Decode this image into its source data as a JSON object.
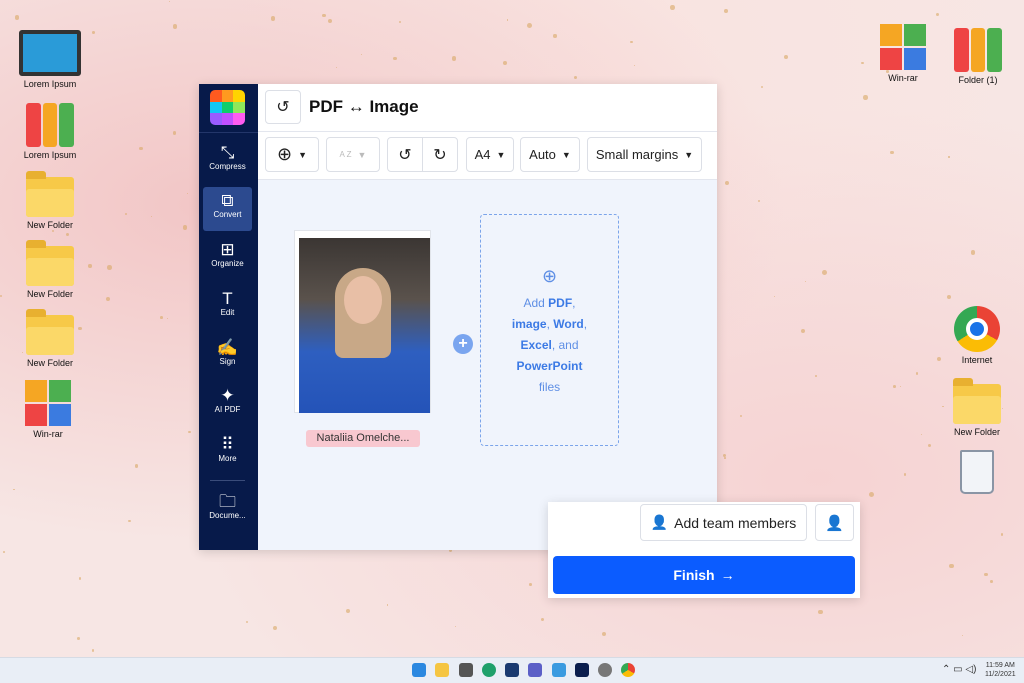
{
  "desktop": {
    "left_icons": [
      {
        "label": "Lorem Ipsum",
        "icon": "monitor-icon"
      },
      {
        "label": "Lorem Ipsum",
        "icon": "binders-icon"
      },
      {
        "label": "New Folder",
        "icon": "folder-icon"
      },
      {
        "label": "New Folder",
        "icon": "folder-icon"
      },
      {
        "label": "New Folder",
        "icon": "folder-icon"
      },
      {
        "label": "Win-rar",
        "icon": "winrar-icon"
      }
    ],
    "right_icons": [
      {
        "label": "Win-rar",
        "icon": "winrar-icon"
      },
      {
        "label": "Folder (1)",
        "icon": "binders-icon"
      },
      {
        "label": "Internet",
        "icon": "chrome-icon"
      },
      {
        "label": "New Folder",
        "icon": "folder-icon"
      }
    ]
  },
  "app": {
    "title": "PDF ↔ Image",
    "sidebar": [
      {
        "label": "Compress",
        "icon": "compress-icon"
      },
      {
        "label": "Convert",
        "icon": "convert-icon",
        "active": true
      },
      {
        "label": "Organize",
        "icon": "organize-icon"
      },
      {
        "label": "Edit",
        "icon": "edit-icon"
      },
      {
        "label": "Sign",
        "icon": "sign-icon"
      },
      {
        "label": "AI PDF",
        "icon": "sparkle-icon"
      },
      {
        "label": "More",
        "icon": "grid-icon"
      },
      {
        "label": "Docume...",
        "icon": "folder-icon"
      }
    ],
    "toolbar": {
      "page_size": "A4",
      "orientation": "Auto",
      "margins": "Small margins",
      "sort_label": "A Z"
    },
    "file": {
      "name": "Nataliia Omelche..."
    },
    "dropzone": {
      "t1": "Add ",
      "b1": "PDF",
      "t2": ",",
      "b2": "image",
      "t3": ", ",
      "b3": "Word",
      "t4": ",",
      "b4": "Excel",
      "t5": ", and",
      "b5": "PowerPoint",
      "t6": "files"
    }
  },
  "panel": {
    "add_team": "Add team members",
    "finish": "Finish"
  },
  "taskbar": {
    "time": "11:59 AM",
    "date": "11/2/2021"
  },
  "colors": {
    "sidebar": "#071a4a",
    "accent": "#0b5cff",
    "filename_bg": "#f8c8d0"
  }
}
